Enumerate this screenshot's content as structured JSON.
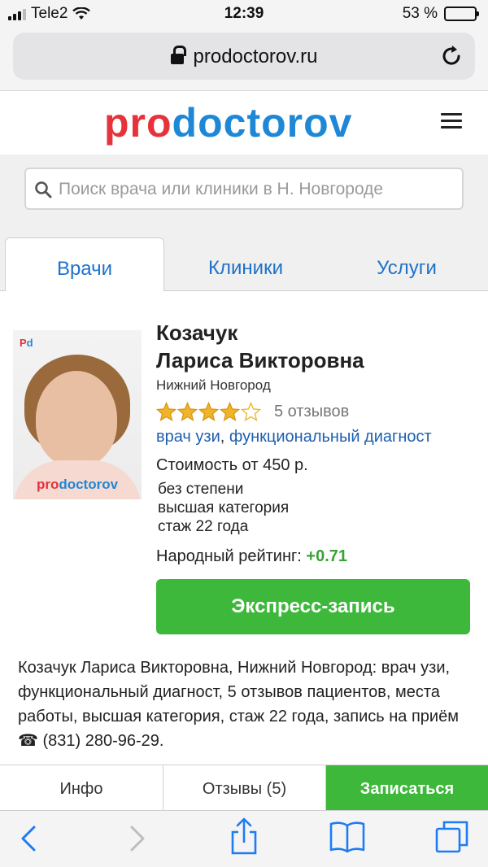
{
  "status_bar": {
    "carrier": "Tele2",
    "time": "12:39",
    "battery": "53 %",
    "battery_level": 0.53
  },
  "browser": {
    "url": "prodoctorov.ru"
  },
  "site": {
    "logo_part1": "pro",
    "logo_part2": "doctorov"
  },
  "search": {
    "placeholder": "Поиск врача или клиники в Н. Новгороде"
  },
  "tabs": [
    {
      "label": "Врачи",
      "active": true
    },
    {
      "label": "Клиники",
      "active": false
    },
    {
      "label": "Услуги",
      "active": false
    }
  ],
  "doctor": {
    "surname": "Козачук",
    "given_names": "Лариса Викторовна",
    "city": "Нижний Новгород",
    "rating_stars": 4,
    "reviews": "5 отзывов",
    "specialty_1": "врач узи",
    "specialty_sep": ",",
    "specialty_2": "функциональный диагност",
    "cost": "Стоимость от 450 р.",
    "degree": "без степени",
    "category": "высшая категория",
    "experience": "стаж 22 года",
    "folk_rating_label": "Народный рейтинг:",
    "folk_rating_value": "+0.71",
    "photo_watermark_1": "pro",
    "photo_watermark_2": "doctorov",
    "express_button": "Экспресс-запись"
  },
  "description": "Козачук Лариса Викторовна, Нижний Новгород: врач узи, функциональный диагност, 5 отзывов пациентов, места работы, высшая категория, стаж 22 года, запись на приём ☎ (831) 280-96-29.",
  "bottom_tabs": {
    "info": "Инфо",
    "reviews": "Отзывы (5)",
    "book": "Записаться"
  },
  "colors": {
    "brand_red": "#e5323b",
    "brand_blue": "#1e88d6",
    "green": "#3db83a",
    "star": "#f0b429"
  }
}
